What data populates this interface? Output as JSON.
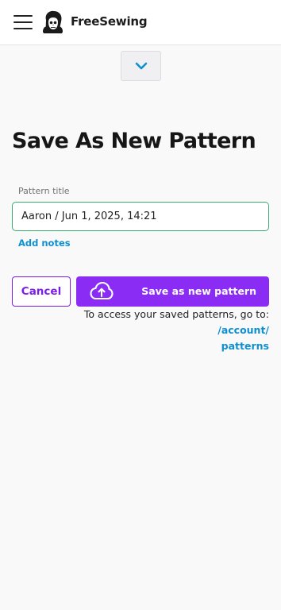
{
  "header": {
    "menu_icon": "hamburger-menu-icon",
    "logo_icon": "freesewing-skully-logo",
    "brand": "FreeSewing"
  },
  "collapse_toggle": {
    "icon": "chevron-down-icon"
  },
  "page": {
    "title": "Save As New Pattern"
  },
  "form": {
    "pattern_title_label": "Pattern title",
    "pattern_title_value": "Aaron / Jun 1, 2025, 14:21",
    "add_notes": "Add notes"
  },
  "actions": {
    "cancel": "Cancel",
    "save": "Save as new pattern",
    "save_icon": "cloud-upload-icon"
  },
  "note": {
    "text": "To access your saved patterns, go to:",
    "link_line1": "/account/",
    "link_line2": "patterns"
  },
  "colors": {
    "accent": "#8b2cf5",
    "link": "#0e8fd0",
    "input_border": "#3aaa6e"
  }
}
